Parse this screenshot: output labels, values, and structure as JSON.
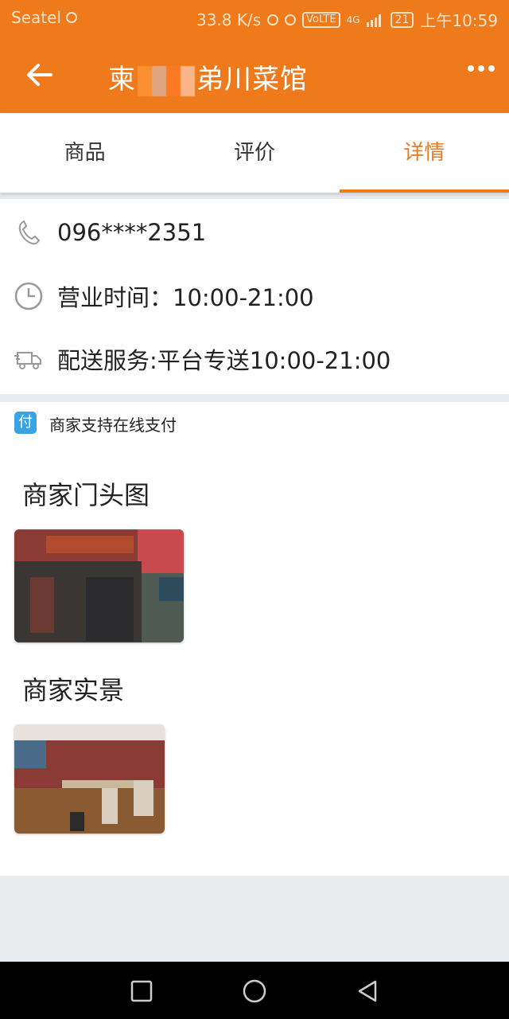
{
  "status_bar": {
    "carrier": "Seatel",
    "speed": "33.8 K/s",
    "network_badge": "VoLTE",
    "signal_label": "4G",
    "battery": "21",
    "time": "上午10:59"
  },
  "app_bar": {
    "title_prefix": "柬",
    "title_suffix": "弟川菜馆",
    "back_icon": "arrow-left-icon",
    "more_icon": "more-dots-icon"
  },
  "tabs": [
    {
      "label": "商品",
      "active": false
    },
    {
      "label": "评价",
      "active": false
    },
    {
      "label": "详情",
      "active": true
    }
  ],
  "info": {
    "phone": "096****2351",
    "hours": "营业时间：10:00-21:00",
    "delivery": "配送服务:平台专送10:00-21:00"
  },
  "payment": {
    "badge": "付",
    "text": "商家支持在线支付"
  },
  "sections": {
    "storefront_title": "商家门头图",
    "interior_title": "商家实景"
  },
  "colors": {
    "accent": "#ef7a1c",
    "pay_badge": "#3aa3e3"
  }
}
